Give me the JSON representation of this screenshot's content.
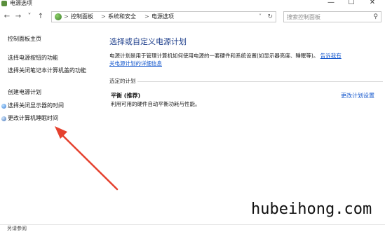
{
  "window": {
    "title": "电源选项",
    "minimize": "—",
    "maximize": "☐",
    "close": "✕"
  },
  "nav": {
    "back": "←",
    "forward": "→",
    "recent": "˅",
    "up": "↑"
  },
  "breadcrumb": {
    "items": [
      "控制面板",
      "系统和安全",
      "电源选项"
    ],
    "separator": ">"
  },
  "address_dropdown": "˅",
  "address_refresh": "↻",
  "search": {
    "placeholder": "搜索控制面板"
  },
  "sidebar": {
    "items": [
      {
        "label": "控制面板主页"
      },
      {
        "label": "选择电源按钮的功能"
      },
      {
        "label": "选择关闭笔记本计算机盖的功能"
      },
      {
        "label": "创建电源计划"
      },
      {
        "label": "选择关闭显示器的时间"
      },
      {
        "label": "更改计算机睡眠时间"
      }
    ]
  },
  "main": {
    "heading": "选择或自定义电源计划",
    "description": "电源计划是用于管理计算机如何使用电源的一套硬件和系统设置(如显示器亮度、睡眠等)。",
    "desc_link": "告诉我有",
    "desc_link2": "关电源计划的详细信息",
    "section_label": "选定的计划",
    "plan_name": "平衡 (推荐)",
    "plan_desc": "利用可用的硬件自动平衡功耗与性能。",
    "plan_change": "更改计划设置"
  },
  "watermark": "hubeihong.com",
  "footer": "另请参阅",
  "colors": {
    "heading": "#1e3f8c",
    "link": "#1155cc",
    "arrow": "#e5412e"
  }
}
